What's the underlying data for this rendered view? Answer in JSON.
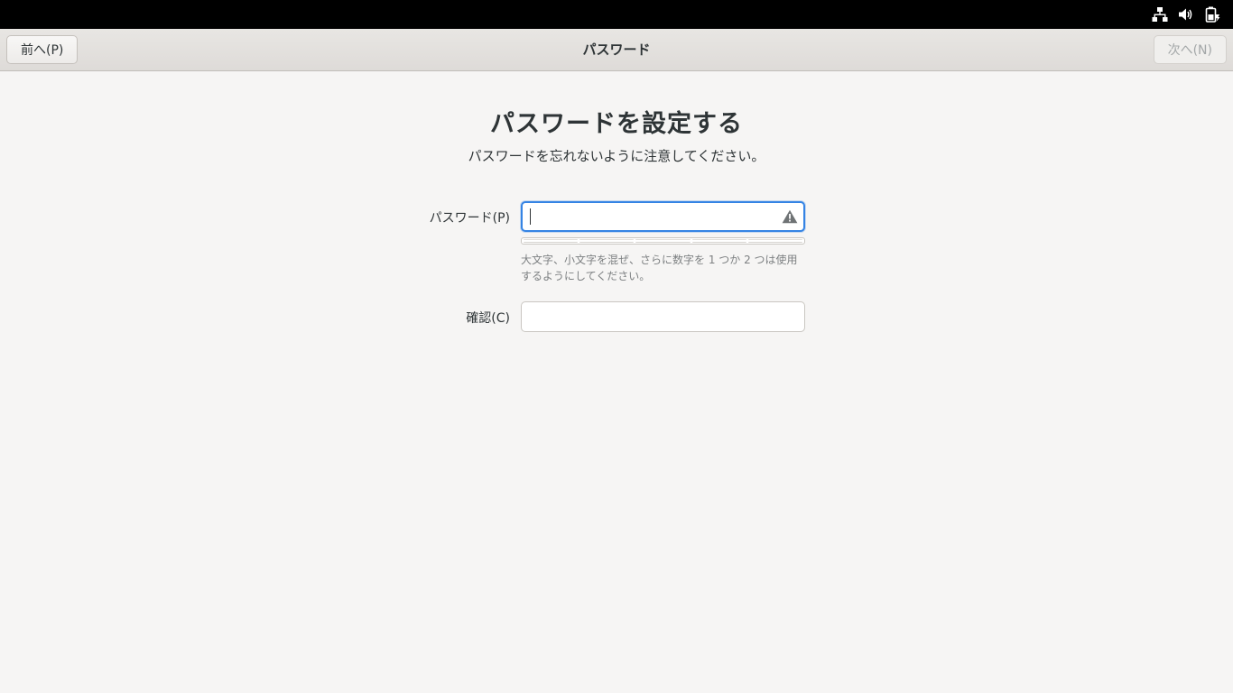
{
  "system_tray": {
    "icons": [
      "network-wired-icon",
      "volume-icon",
      "battery-icon"
    ]
  },
  "header": {
    "prev_label": "前へ(P)",
    "title": "パスワード",
    "next_label": "次へ(N)"
  },
  "main": {
    "title": "パスワードを設定する",
    "subtitle": "パスワードを忘れないように注意してください。"
  },
  "form": {
    "password_label": "パスワード(P)",
    "password_value": "",
    "strength_segments": 5,
    "strength_level": 0,
    "hint": "大文字、小文字を混ぜ、さらに数字を 1 つか 2 つは使用するようにしてください。",
    "confirm_label": "確認(C)",
    "confirm_value": ""
  },
  "colors": {
    "focus_accent": "#3584e4",
    "background": "#f6f5f4",
    "top_panel": "#000000"
  }
}
